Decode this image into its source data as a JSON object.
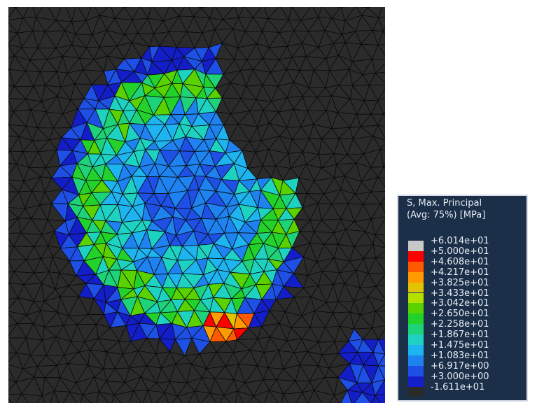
{
  "legend": {
    "title_line1": "S, Max. Principal",
    "title_line2": "(Avg: 75%) [MPa]",
    "entries": [
      "+6.014e+01",
      "+5.000e+01",
      "+4.608e+01",
      "+4.217e+01",
      "+3.825e+01",
      "+3.433e+01",
      "+3.042e+01",
      "+2.650e+01",
      "+2.258e+01",
      "+1.867e+01",
      "+1.475e+01",
      "+1.083e+01",
      "+6.917e+00",
      "+3.000e+00",
      "-1.611e+01"
    ],
    "colors": [
      "#c8c8c8",
      "#ff0000",
      "#ff5a00",
      "#ff9a00",
      "#e0c400",
      "#b4e000",
      "#5ad200",
      "#22d22a",
      "#1ed27a",
      "#1ed2c2",
      "#1eb4f0",
      "#1e82f0",
      "#1e50e6",
      "#141ec8",
      "#2a2a2a"
    ]
  },
  "mesh": {
    "background_color": "#2b2b2b",
    "edge_color": "#0a0a0a"
  }
}
